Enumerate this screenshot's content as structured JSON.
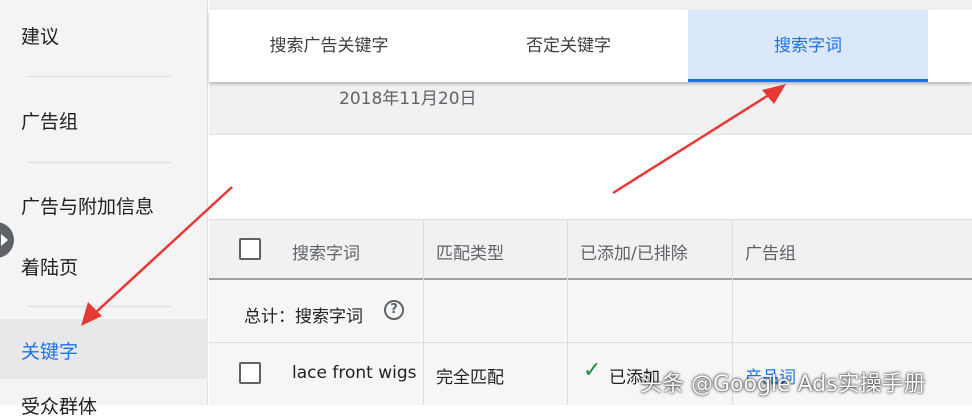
{
  "sidebar": {
    "items": [
      {
        "label": "建议"
      },
      {
        "label": "广告组"
      },
      {
        "label": "广告与附加信息"
      },
      {
        "label": "着陆页"
      },
      {
        "label": "关键字"
      },
      {
        "label": "受众群体"
      }
    ],
    "active_index": 4
  },
  "tabs": [
    {
      "label": "搜索广告关键字"
    },
    {
      "label": "否定关键字"
    },
    {
      "label": "搜索字词"
    }
  ],
  "active_tab": "搜索字词",
  "date_text": "2018年11月20日",
  "table": {
    "columns": [
      "搜索字词",
      "匹配类型",
      "已添加/已排除",
      "广告组"
    ],
    "total_label": "总计：搜索字词",
    "rows": [
      {
        "term": "lace front wigs",
        "match_type": "完全匹配",
        "status": "已添加",
        "ad_group": "产品词"
      }
    ]
  },
  "watermark": "头条 @Google Ads实操手册",
  "colors": {
    "accent": "#1a73e8",
    "arrow": "#e53935",
    "success": "#1e8e3e"
  },
  "icons": [
    "collapse-arrow-icon",
    "help-icon",
    "check-icon"
  ]
}
